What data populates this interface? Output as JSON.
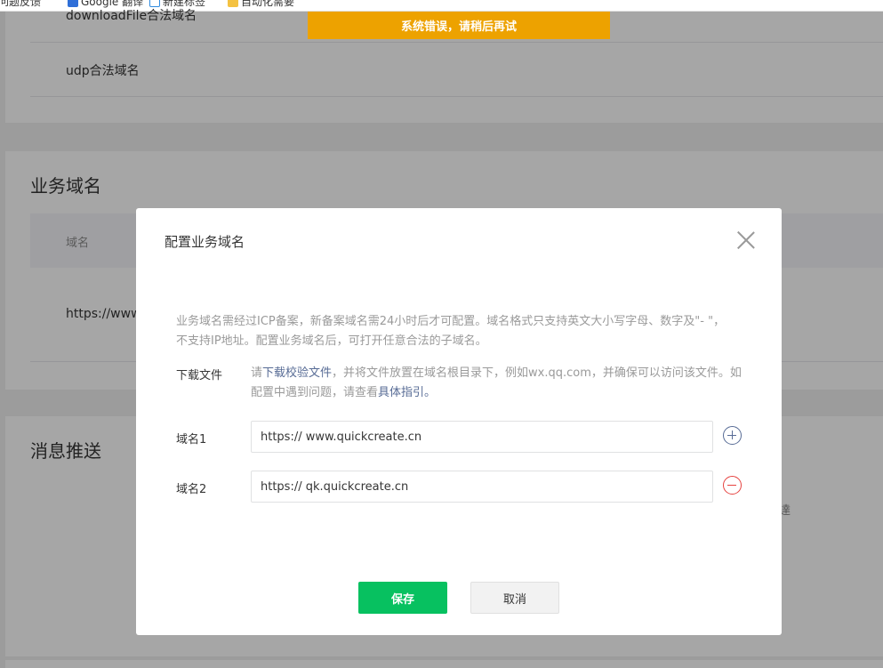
{
  "browser": {
    "bookmarks": [
      "问题反馈",
      "Google 翻译",
      "新建标签",
      "自动化需要"
    ]
  },
  "background": {
    "rows": [
      {
        "label": "downloadFile合法域名"
      },
      {
        "label": "udp合法域名"
      }
    ],
    "business_domain_section": {
      "title": "业务域名",
      "column_header": "域名",
      "first_cell": "https://www"
    },
    "message_push_section": {
      "title": "消息推送",
      "partial_char": "達"
    }
  },
  "toast": {
    "message": "系统错误，请稍后再试",
    "color": "#eda200"
  },
  "modal": {
    "title": "配置业务域名",
    "close_icon": "close-icon",
    "notice": "业务域名需经过ICP备案，新备案域名需24小时后才可配置。域名格式只支持英文大小写字母、数字及\"- \"，不支持IP地址。配置业务域名后，可打开任意合法的子域名。",
    "download": {
      "label": "下载文件",
      "prefix": "请",
      "link_text": "下载校验文件",
      "middle": "，并将文件放置在域名根目录下，例如wx.qq.com，并确保可以访问该文件。如配置中遇到问题，请查看",
      "guide_link": "具体指引",
      "suffix": "。"
    },
    "fields": [
      {
        "label": "域名1",
        "value": "https:// www.quickcreate.cn",
        "action_icon": "plus-circle-icon"
      },
      {
        "label": "域名2",
        "value": "https:// qk.quickcreate.cn",
        "action_icon": "minus-circle-icon"
      }
    ],
    "buttons": {
      "save": "保存",
      "cancel": "取消"
    }
  },
  "colors": {
    "primary_green": "#07c160",
    "link_blue": "#576b95",
    "danger_red": "#e64340"
  }
}
